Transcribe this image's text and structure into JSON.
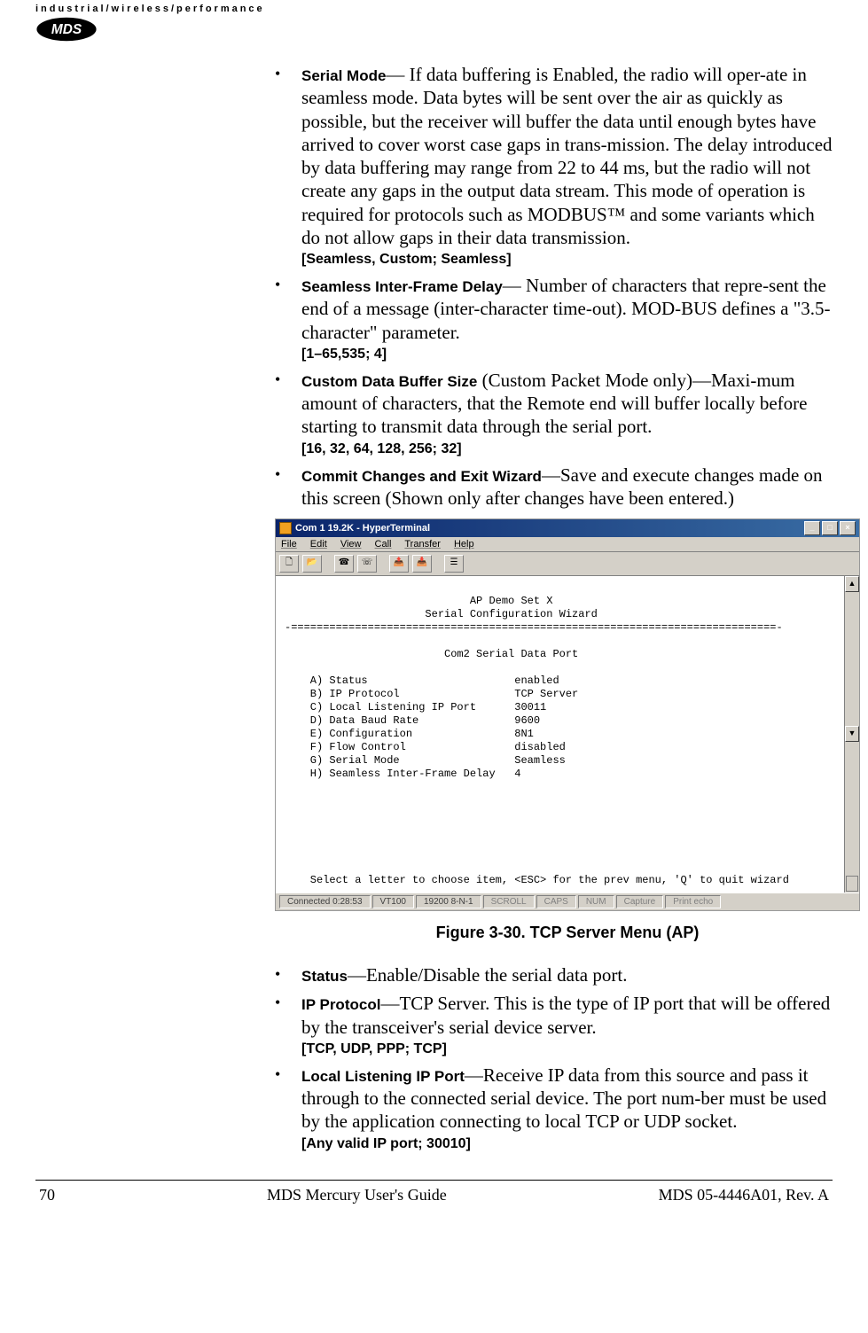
{
  "header": {
    "tagline": "industrial/wireless/performance",
    "logo_text": "MDS"
  },
  "bullets_top": [
    {
      "term": "Serial Mode",
      "sep": "— ",
      "text": "If data buffering is Enabled, the radio will oper-ate in seamless mode. Data bytes will be sent over the air as quickly as possible, but the receiver will buffer the data until enough bytes have arrived to cover worst case gaps in trans-mission. The delay introduced by data buffering may range from 22 to 44 ms, but the radio will not create any gaps in the output data stream. This mode of operation is required for protocols such as MODBUS™ and some variants which do not allow gaps in their data transmission.",
      "opts": "[Seamless, Custom; Seamless]"
    },
    {
      "term": "Seamless Inter-Frame Delay",
      "sep": "— ",
      "text": "Number of characters that repre-sent the end of a message (inter-character time-out). MOD-BUS defines a \"3.5-character\" parameter.",
      "opts": "[1–65,535; 4]"
    },
    {
      "term": "Custom Data Buffer Size",
      "sep": "  ",
      "text": "(Custom Packet Mode only)—Maxi-mum amount of characters, that the Remote end will buffer locally before starting to transmit data through the serial port.",
      "opts": "[16, 32, 64, 128, 256; 32]"
    },
    {
      "term": "Commit Changes and Exit Wizard",
      "sep": "—",
      "text": "Save and execute changes made on this screen (Shown only after changes have been entered.)",
      "opts": ""
    }
  ],
  "terminal": {
    "title": "Com 1 19.2K - HyperTerminal",
    "menus": [
      "File",
      "Edit",
      "View",
      "Call",
      "Transfer",
      "Help"
    ],
    "heading1": "AP Demo Set X",
    "heading2": "Serial Configuration Wizard",
    "rule": "-============================================================================-",
    "subtitle": "Com2 Serial Data Port",
    "rows": [
      {
        "k": "A) Status",
        "v": "enabled"
      },
      {
        "k": "B) IP Protocol",
        "v": "TCP Server"
      },
      {
        "k": "C) Local Listening IP Port",
        "v": "30011"
      },
      {
        "k": "D) Data Baud Rate",
        "v": "9600"
      },
      {
        "k": "E) Configuration",
        "v": "8N1"
      },
      {
        "k": "F) Flow Control",
        "v": "disabled"
      },
      {
        "k": "G) Serial Mode",
        "v": "Seamless"
      },
      {
        "k": "H) Seamless Inter-Frame Delay",
        "v": "4"
      }
    ],
    "prompt": "Select a letter to choose item, <ESC> for the prev menu, 'Q' to quit wizard",
    "status": {
      "conn": "Connected 0:28:53",
      "emul": "VT100",
      "cfg": "19200 8-N-1",
      "cells": [
        "SCROLL",
        "CAPS",
        "NUM",
        "Capture",
        "Print echo"
      ]
    }
  },
  "figure_caption": "Figure 3-30. TCP Server Menu (AP)",
  "bullets_bottom": [
    {
      "term": "Status",
      "sep": "—",
      "text": "Enable/Disable the serial data port.",
      "opts": ""
    },
    {
      "term": "IP Protocol",
      "sep": "—",
      "text": "TCP Server. This is the type of IP port that will be offered by the transceiver's serial device server.",
      "opts": "[TCP, UDP, PPP; TCP]"
    },
    {
      "term": "Local Listening IP Port",
      "sep": "—",
      "text": "Receive IP data from this source and pass it through to the connected serial device. The port num-ber must be used by the application connecting to local TCP or UDP socket.",
      "opts": "[Any valid IP port; 30010]"
    }
  ],
  "footer": {
    "page": "70",
    "center": "MDS Mercury User's Guide",
    "right": "MDS 05-4446A01, Rev. A"
  }
}
